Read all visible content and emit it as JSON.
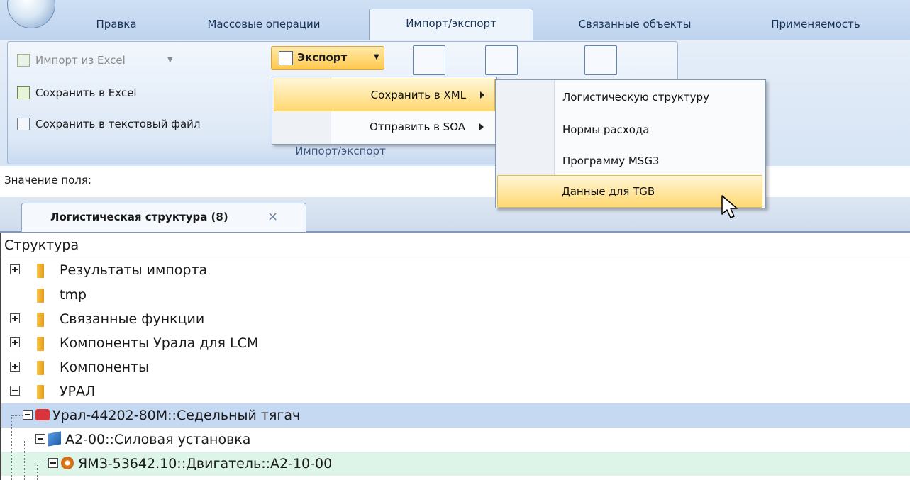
{
  "ribbon": {
    "tabs": [
      {
        "label": "Правка"
      },
      {
        "label": "Массовые операции"
      },
      {
        "label": "Импорт/экспорт"
      },
      {
        "label": "Связанные объекты"
      },
      {
        "label": "Применяемость"
      }
    ],
    "import_excel": "Импорт из Excel",
    "save_excel": "Сохранить в Excel",
    "save_text": "Сохранить в текстовый файл",
    "export_label": "Экспорт",
    "group_title": "Импорт/экспорт"
  },
  "export_menu": {
    "items": [
      {
        "label": "Сохранить в XML"
      },
      {
        "label": "Отправить в SOA"
      }
    ]
  },
  "xml_submenu": {
    "items": [
      {
        "label": "Логистическую структуру"
      },
      {
        "label": "Нормы расхода"
      },
      {
        "label": "Программу MSG3"
      },
      {
        "label": "Данные для TGB"
      }
    ]
  },
  "field_bar": {
    "label": "Значение поля:"
  },
  "document_tab": {
    "label": "Логистическая структура (8)",
    "close": "×"
  },
  "tree": {
    "header": "Структура",
    "rows": [
      {
        "label": "Результаты импорта"
      },
      {
        "label": "tmp"
      },
      {
        "label": "Связанные функции"
      },
      {
        "label": "Компоненты Урала для LCM"
      },
      {
        "label": "Компоненты"
      },
      {
        "label": "УРАЛ"
      },
      {
        "label": "Урал-44202-80М::Седельный тягач"
      },
      {
        "label": "А2-00::Силовая установка"
      },
      {
        "label": "ЯМЗ-53642.10::Двигатель::А2-10-00"
      }
    ]
  },
  "colors": {
    "selected_row": "#c5daf2",
    "green_row": "#dcf5e8",
    "highlight": "#ffd870"
  }
}
